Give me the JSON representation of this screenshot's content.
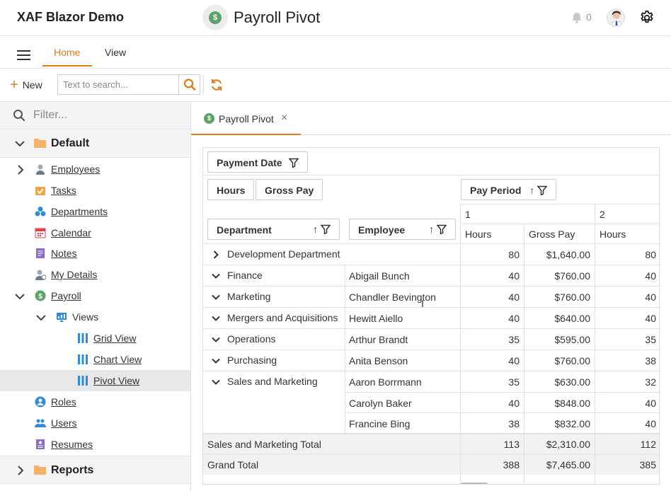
{
  "header": {
    "app_title": "XAF Blazor Demo",
    "page_title": "Payroll Pivot",
    "page_icon_glyph": "$",
    "notification_count": "0",
    "icons": [
      "coin-icon",
      "bell-icon",
      "avatar",
      "gear-icon"
    ]
  },
  "ribbon": {
    "tabs": [
      {
        "label": "Home",
        "active": true
      },
      {
        "label": "View",
        "active": false
      }
    ]
  },
  "toolbar": {
    "new_label": "New",
    "search_placeholder": "Text to search..."
  },
  "sidebar": {
    "filter_placeholder": "Filter...",
    "groups": [
      {
        "label": "Default",
        "expanded": true
      },
      {
        "label": "Reports",
        "expanded": false
      }
    ],
    "items": [
      {
        "label": "Employees",
        "icon": "employee-icon",
        "level": 1,
        "expander": "collapsed"
      },
      {
        "label": "Tasks",
        "icon": "tasks-icon",
        "level": 1
      },
      {
        "label": "Departments",
        "icon": "departments-icon",
        "level": 1
      },
      {
        "label": "Calendar",
        "icon": "calendar-icon",
        "level": 1
      },
      {
        "label": "Notes",
        "icon": "notes-icon",
        "level": 1
      },
      {
        "label": "My Details",
        "icon": "my-details-icon",
        "level": 1
      },
      {
        "label": "Payroll",
        "icon": "payroll-icon",
        "level": 1,
        "expander": "expanded"
      },
      {
        "label": "Views",
        "icon": "views-icon",
        "level": 2,
        "expander": "expanded",
        "underline": false
      },
      {
        "label": "Grid View",
        "icon": "grid-view-icon",
        "level": 3
      },
      {
        "label": "Chart View",
        "icon": "grid-view-icon",
        "level": 3
      },
      {
        "label": "Pivot View",
        "icon": "grid-view-icon",
        "level": 3,
        "selected": true
      },
      {
        "label": "Roles",
        "icon": "roles-icon",
        "level": 1
      },
      {
        "label": "Users",
        "icon": "users-icon",
        "level": 1
      },
      {
        "label": "Resumes",
        "icon": "resumes-icon",
        "level": 1
      }
    ]
  },
  "document_tab": {
    "label": "Payroll Pivot",
    "icon_glyph": "$",
    "close_glyph": "×"
  },
  "pivot": {
    "filter_field": "Payment Date",
    "data_fields": [
      "Hours",
      "Gross Pay"
    ],
    "column_field": "Pay Period",
    "row_fields": [
      "Department",
      "Employee"
    ],
    "column_values": [
      "1",
      "2"
    ],
    "measure_headers": [
      "Hours",
      "Gross Pay",
      "Hours"
    ],
    "rows": [
      {
        "department": "Development Department",
        "expand": "collapsed",
        "employee": "",
        "h1": "80",
        "g1": "$1,640.00",
        "h2": "80"
      },
      {
        "department": "Finance",
        "expand": "expanded",
        "employee": "Abigail Bunch",
        "h1": "40",
        "g1": "$760.00",
        "h2": "40"
      },
      {
        "department": "Marketing",
        "expand": "expanded",
        "employee": "Chandler Bevington",
        "h1": "40",
        "g1": "$760.00",
        "h2": "40"
      },
      {
        "department": "Mergers and Acquisitions",
        "expand": "expanded",
        "employee": "Hewitt Aiello",
        "h1": "40",
        "g1": "$640.00",
        "h2": "40"
      },
      {
        "department": "Operations",
        "expand": "expanded",
        "employee": "Arthur Brandt",
        "h1": "35",
        "g1": "$595.00",
        "h2": "35"
      },
      {
        "department": "Purchasing",
        "expand": "expanded",
        "employee": "Anita Benson",
        "h1": "40",
        "g1": "$760.00",
        "h2": "38"
      },
      {
        "department": "Sales and Marketing",
        "expand": "expanded",
        "employee": "Aaron Borrmann",
        "h1": "35",
        "g1": "$630.00",
        "h2": "32"
      },
      {
        "department": "",
        "employee": "Carolyn Baker",
        "h1": "40",
        "g1": "$848.00",
        "h2": "40"
      },
      {
        "department": "",
        "employee": "Francine Bing",
        "h1": "38",
        "g1": "$832.00",
        "h2": "40"
      }
    ],
    "totals": [
      {
        "label": "Sales and Marketing Total",
        "h1": "113",
        "g1": "$2,310.00",
        "h2": "112"
      },
      {
        "label": "Grand Total",
        "h1": "388",
        "g1": "$7,465.00",
        "h2": "385"
      }
    ]
  },
  "colors": {
    "accent": "#e07b1a",
    "payroll_green": "#5aa469",
    "folder": "#f5b16a",
    "icon_blue": "#2f8ad8",
    "selected_bg": "#e8e8e8"
  }
}
